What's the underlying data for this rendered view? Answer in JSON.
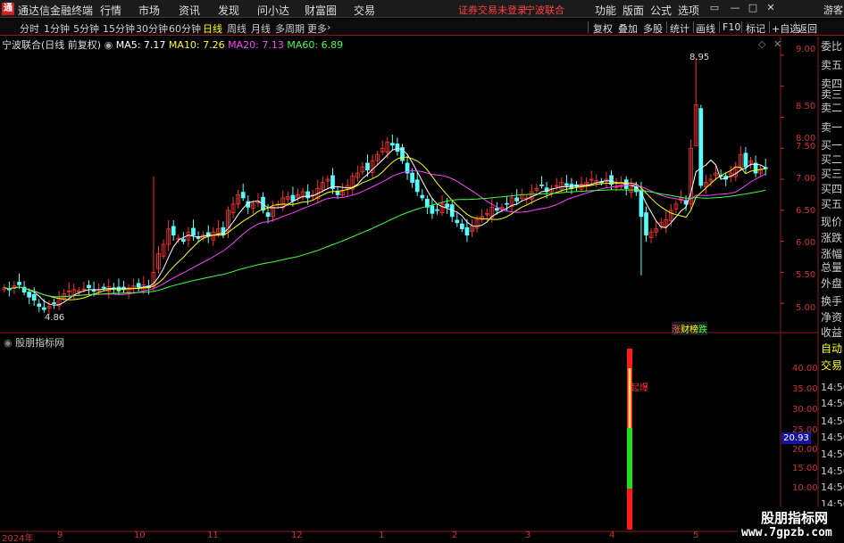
{
  "titlebar": {
    "app_title": "通达信金融终端",
    "menu": [
      "行情",
      "市场",
      "资讯",
      "发现",
      "问小达",
      "财富圈",
      "交易"
    ],
    "warning": "证券交易未登录",
    "stock_name": "宁波联合",
    "right_menu": [
      "功能",
      "版面",
      "公式",
      "选项"
    ],
    "user": "游客"
  },
  "toolbar": {
    "periods": [
      "分时",
      "1分钟",
      "5分钟",
      "15分钟",
      "30分钟",
      "60分钟",
      "日线",
      "周线",
      "月线",
      "多周期",
      "更多"
    ],
    "active_period": "日线",
    "tools": [
      "复权",
      "叠加",
      "多股",
      "统计",
      "画线",
      "F10",
      "标记",
      "+自选",
      "返回"
    ]
  },
  "chart": {
    "title": "宁波联合(日线 前复权)",
    "ma5": "MA5: 7.17",
    "ma10": "MA10: 7.26",
    "ma20": "MA20: 7.13",
    "ma60": "MA60: 6.89",
    "high_marker": "8.95",
    "low_marker": "4.86",
    "y_ticks": [
      "9.00",
      "8.50",
      "8.00",
      "7.50",
      "7.00",
      "6.50",
      "6.00",
      "5.50",
      "5.00"
    ],
    "badge": [
      "涨",
      "财",
      "榜",
      "跌"
    ],
    "x_labels": [
      "2024年",
      "9",
      "10",
      "11",
      "12",
      "1",
      "2",
      "3",
      "4",
      "5"
    ]
  },
  "indicator": {
    "title": "股朋指标网",
    "y_ticks": [
      "40.00",
      "35.00",
      "30.00",
      "25.00",
      "20.00",
      "15.00",
      "10.00"
    ],
    "current_value": "20.93",
    "signal_label": "起爆"
  },
  "right_panel": {
    "labels": [
      "委比",
      "卖五",
      "卖四",
      "卖三",
      "卖二",
      "卖一",
      "买一",
      "买二",
      "买三",
      "买四",
      "买五",
      "现价",
      "涨跌",
      "涨幅",
      "总量",
      "外盘",
      "换手",
      "净资",
      "收益",
      "自动",
      "交易"
    ],
    "times": [
      "14:56",
      "14:56",
      "14:56",
      "14:56",
      "14:56",
      "14:56",
      "14:56",
      "14:56",
      "14:56",
      "14:5"
    ]
  },
  "watermark": {
    "line1": "股朋指标网",
    "line2": "www.7gpzb.com"
  },
  "chart_data": {
    "type": "candlestick",
    "title": "宁波联合(日线 前复权)",
    "ylim": [
      4.6,
      9.2
    ],
    "yticks": [
      5.0,
      5.5,
      6.0,
      6.5,
      7.0,
      7.5,
      8.0,
      8.5,
      9.0
    ],
    "x_labels": [
      "2024年",
      "9",
      "10",
      "11",
      "12",
      "1",
      "2",
      "3",
      "4",
      "5"
    ],
    "close": [
      5.25,
      5.22,
      5.28,
      5.3,
      5.18,
      5.1,
      5.05,
      4.95,
      4.9,
      4.95,
      5.0,
      5.08,
      5.15,
      5.2,
      5.22,
      5.2,
      5.23,
      5.25,
      5.2,
      5.22,
      5.25,
      5.27,
      5.24,
      5.2,
      5.22,
      5.25,
      5.28,
      5.26,
      5.3,
      5.25,
      5.5,
      5.8,
      5.95,
      6.2,
      6.1,
      6.05,
      6.0,
      6.15,
      6.1,
      6.05,
      6.1,
      6.08,
      6.15,
      6.2,
      6.1,
      6.5,
      6.6,
      6.75,
      6.7,
      6.55,
      6.6,
      6.65,
      6.5,
      6.4,
      6.55,
      6.6,
      6.7,
      6.72,
      6.65,
      6.75,
      6.8,
      6.7,
      6.75,
      6.85,
      6.95,
      7.0,
      6.85,
      6.75,
      6.8,
      6.9,
      7.05,
      7.1,
      7.2,
      7.15,
      7.3,
      7.4,
      7.5,
      7.6,
      7.55,
      7.45,
      7.3,
      7.1,
      6.95,
      6.8,
      6.7,
      6.55,
      6.45,
      6.5,
      6.6,
      6.55,
      6.4,
      6.3,
      6.2,
      6.1,
      6.25,
      6.35,
      6.4,
      6.45,
      6.55,
      6.5,
      6.55,
      6.6,
      6.7,
      6.65,
      6.75,
      6.7,
      6.8,
      6.85,
      6.9,
      6.8,
      6.85,
      6.9,
      6.95,
      6.9,
      6.85,
      6.88,
      6.92,
      6.95,
      7.0,
      6.98,
      6.95,
      7.0,
      6.92,
      6.88,
      6.95,
      6.85,
      6.9,
      6.8,
      6.4,
      6.1,
      6.15,
      6.2,
      6.3,
      6.35,
      6.5,
      6.6,
      6.7,
      6.6,
      7.5,
      8.2,
      6.9,
      6.95,
      7.0,
      7.1,
      7.05,
      7.0,
      7.1,
      7.2,
      7.4,
      7.2,
      7.3,
      7.1,
      7.15,
      7.17
    ]
  }
}
